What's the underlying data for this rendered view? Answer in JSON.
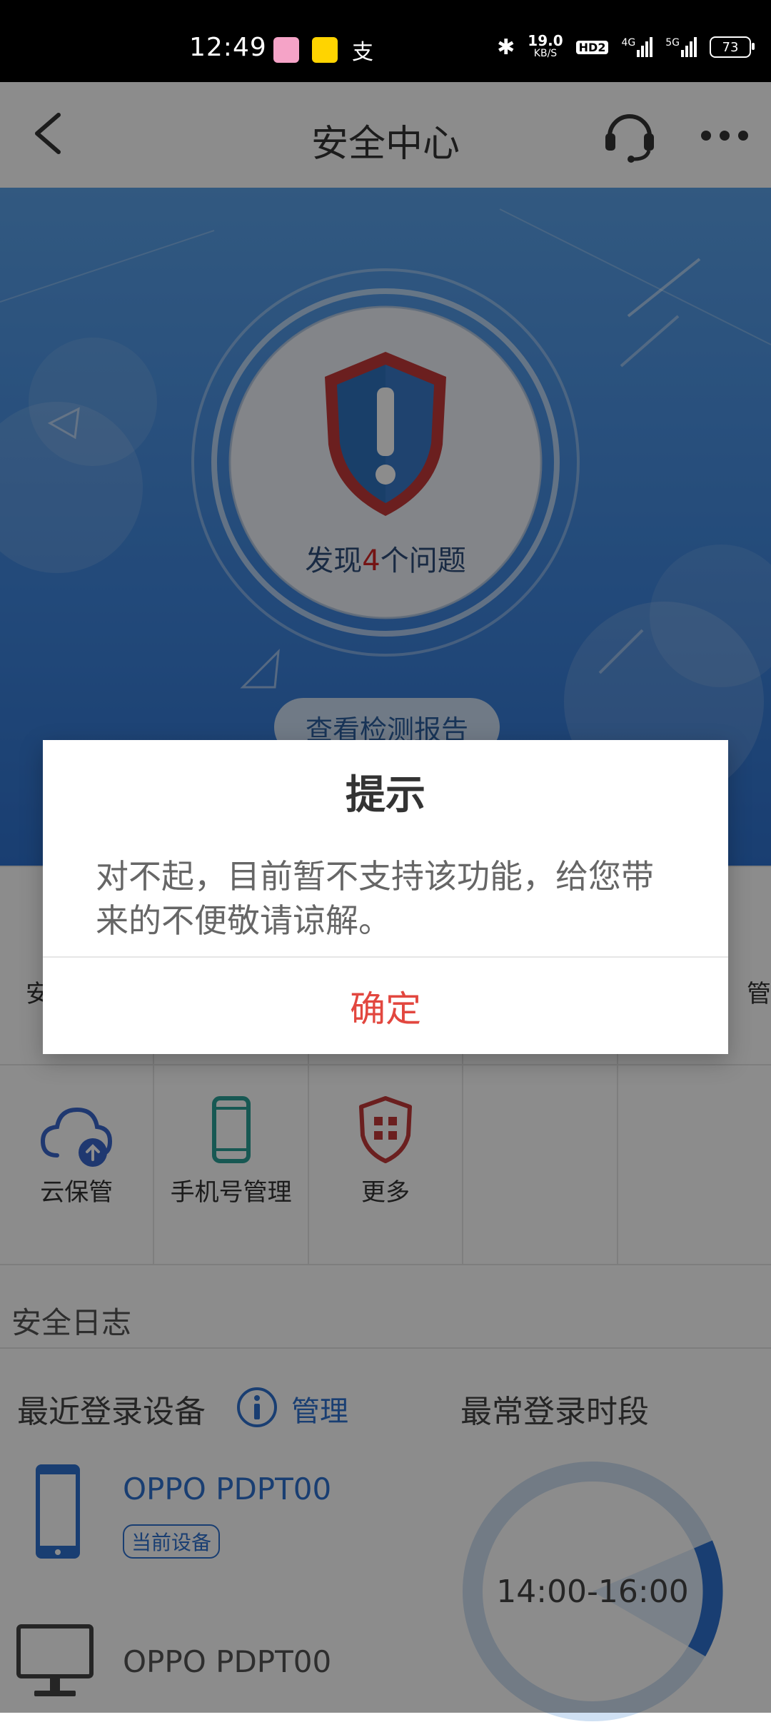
{
  "status_bar": {
    "time": "12:49",
    "net_speed_value": "19.0",
    "net_speed_unit": "KB/S",
    "hd_badge": "HD2",
    "sim1_label": "4G",
    "sim2_label": "5G",
    "battery": "73"
  },
  "header": {
    "title": "安全中心"
  },
  "hero": {
    "label_prefix": "发现",
    "count": "4",
    "label_suffix": "个问题",
    "report_button": "查看检测报告"
  },
  "grid": {
    "row1_partial_left": "安",
    "row1_partial_right": "管",
    "row2": [
      {
        "label": "云保管",
        "icon": "cloud-upload-icon"
      },
      {
        "label": "手机号管理",
        "icon": "phone-icon"
      },
      {
        "label": "更多",
        "icon": "more-grid-icon"
      }
    ]
  },
  "log": {
    "section_title": "安全日志",
    "devices_title": "最近登录设备",
    "manage_label": "管理",
    "period_title": "最常登录时段",
    "period_value": "14:00-16:00",
    "devices": [
      {
        "name": "OPPO PDPT00",
        "tag": "当前设备",
        "icon": "phone-icon"
      },
      {
        "name": "OPPO PDPT00",
        "icon": "monitor-icon"
      }
    ]
  },
  "dialog": {
    "title": "提示",
    "message": "对不起，目前暂不支持该功能，给您带来的不便敬请谅解。",
    "confirm": "确定"
  },
  "colors": {
    "accent_blue": "#2f72cf",
    "confirm_red": "#e2473f",
    "alert_red": "#d42525"
  }
}
